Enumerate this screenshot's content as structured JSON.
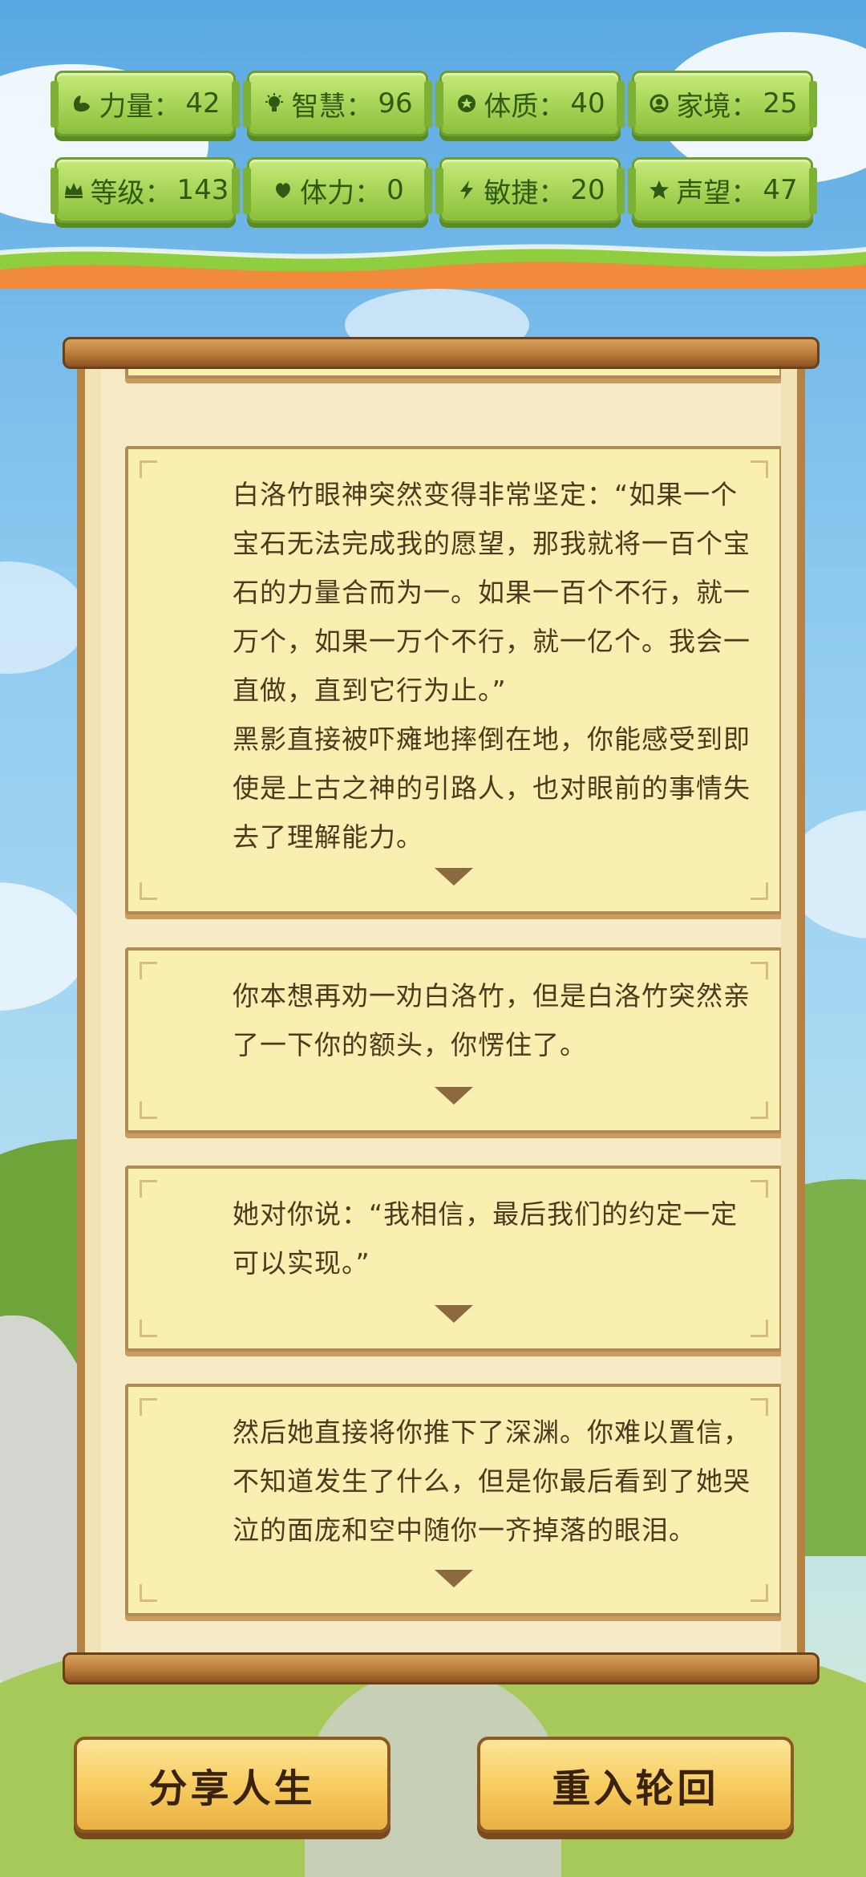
{
  "stats": [
    {
      "icon": "strength-icon",
      "label": "力量：",
      "value": "42"
    },
    {
      "icon": "bulb-icon",
      "label": "智慧：",
      "value": "96"
    },
    {
      "icon": "constitution-icon",
      "label": "体质：",
      "value": "40"
    },
    {
      "icon": "family-icon",
      "label": "家境：",
      "value": "25"
    },
    {
      "icon": "crown-icon",
      "label": "等级：",
      "value": "143"
    },
    {
      "icon": "stamina-icon",
      "label": "体力：",
      "value": "0"
    },
    {
      "icon": "lightning-icon",
      "label": "敏捷：",
      "value": "20"
    },
    {
      "icon": "star-icon",
      "label": "声望：",
      "value": "47"
    }
  ],
  "events": [
    {
      "text": "白洛竹眼神突然变得非常坚定：“如果一个宝石无法完成我的愿望，那我就将一百个宝石的力量合而为一。如果一百个不行，就一万个，如果一万个不行，就一亿个。我会一直做，直到它行为止。”\n黑影直接被吓瘫地摔倒在地，你能感受到即使是上古之神的引路人，也对眼前的事情失去了理解能力。"
    },
    {
      "text": "你本想再劝一劝白洛竹，但是白洛竹突然亲了一下你的额头，你愣住了。"
    },
    {
      "text": "她对你说：“我相信，最后我们的约定一定可以实现。”"
    },
    {
      "text": "然后她直接将你推下了深渊。你难以置信，不知道发生了什么，但是你最后看到了她哭泣的面庞和空中随你一齐掉落的眼泪。"
    }
  ],
  "buttons": {
    "share_label": "分享人生",
    "restart_label": "重入轮回"
  },
  "colors": {
    "stat_green": "#a5d356",
    "card_bg": "#f9efb0",
    "button_gold": "#f7cd61",
    "scroll_wood": "#b87a38"
  }
}
